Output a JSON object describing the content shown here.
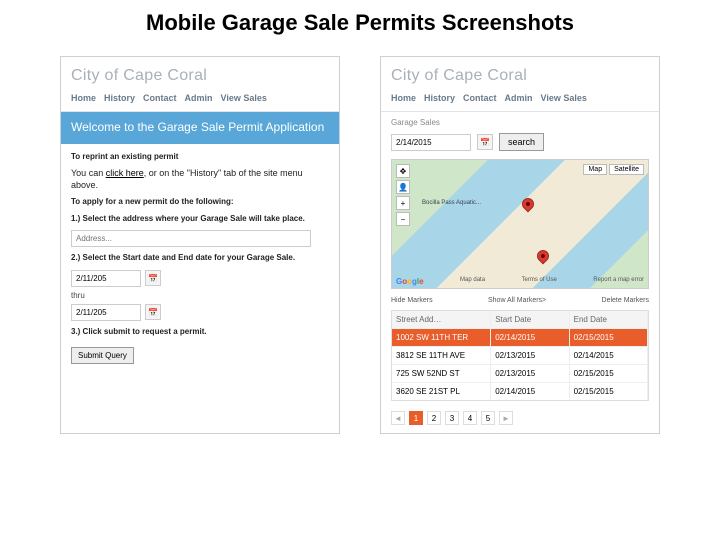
{
  "page_title": "Mobile Garage Sale Permits Screenshots",
  "brand": "City of Cape Coral",
  "nav": [
    "Home",
    "History",
    "Contact",
    "Admin",
    "View Sales"
  ],
  "screen1": {
    "banner": "Welcome to the Garage Sale Permit Application",
    "reprint_head": "To reprint an existing permit",
    "reprint_pre": "You can ",
    "reprint_link": "click here",
    "reprint_post": ", or on the \"History\" tab of the site menu above.",
    "apply_head": "To apply for a new permit do the following:",
    "step1": "1.) Select the address where your Garage Sale will take place.",
    "addr_placeholder": "Address...",
    "step2": "2.) Select the Start date and End date for your Garage Sale.",
    "date_start": "2/11/205",
    "thru": "thru",
    "date_end": "2/11/205",
    "step3": "3.) Click submit to request a permit.",
    "submit": "Submit Query"
  },
  "screen2": {
    "section_label": "Garage Sales",
    "search_date": "2/14/2015",
    "search_btn": "search",
    "map_type": "Map",
    "map_sat": "Satellite",
    "map_label_pass": "Bocilla Pass Aquatic...",
    "map_footer_left": "Map data",
    "map_footer_mid": "Terms of Use",
    "map_footer_right": "Report a map error",
    "hide": "Hide Markers",
    "showall": "Show All Markers>",
    "delete": "Delete Markers",
    "cols": [
      "Street Add…",
      "Start Date",
      "End Date"
    ],
    "rows": [
      {
        "addr": "1002 SW 11TH TER",
        "start": "02/14/2015",
        "end": "02/15/2015"
      },
      {
        "addr": "3812 SE 11TH AVE",
        "start": "02/13/2015",
        "end": "02/14/2015"
      },
      {
        "addr": "725 SW 52ND ST",
        "start": "02/13/2015",
        "end": "02/15/2015"
      },
      {
        "addr": "3620 SE 21ST PL",
        "start": "02/14/2015",
        "end": "02/15/2015"
      }
    ],
    "pager": {
      "prev": "◄",
      "pages": [
        "1",
        "2",
        "3",
        "4",
        "5"
      ],
      "next": "►",
      "active": "1"
    }
  }
}
